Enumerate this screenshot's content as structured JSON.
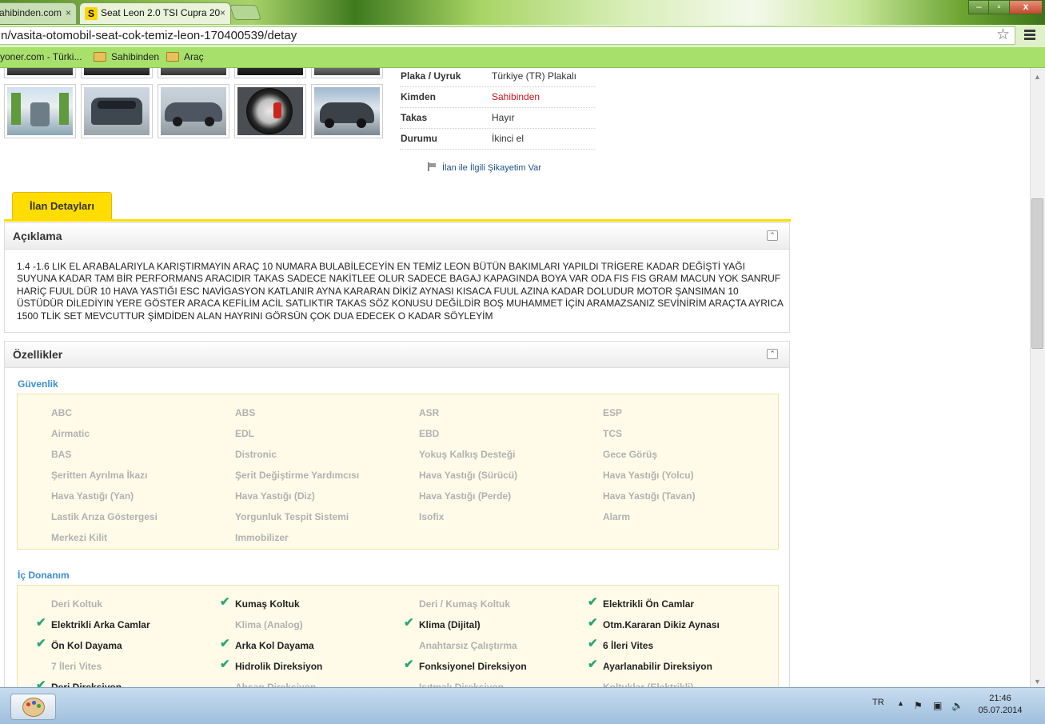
{
  "browser": {
    "tabs": [
      {
        "label": "ahibinden.com",
        "active": false
      },
      {
        "label": "Seat Leon 2.0 TSI Cupra 20",
        "active": true,
        "favicon_letter": "S"
      }
    ],
    "close_glyph": "×",
    "url": "n/vasita-otomobil-seat-cok-temiz-leon-170400539/detay",
    "bookmarks": [
      "yoner.com - Türki...",
      "Sahibinden",
      "Araç"
    ],
    "window_buttons": {
      "minimize": "–",
      "maximize": "▫",
      "close": "x"
    }
  },
  "listing_info": [
    {
      "label": "Plaka / Uyruk",
      "value": "Türkiye (TR) Plakalı",
      "highlight": false
    },
    {
      "label": "Kimden",
      "value": "Sahibinden",
      "highlight": true
    },
    {
      "label": "Takas",
      "value": "Hayır",
      "highlight": false
    },
    {
      "label": "Durumu",
      "value": "İkinci el",
      "highlight": false
    }
  ],
  "complaint_link": "İlan ile İlgili Şikayetim Var",
  "detail_tab": "İlan Detayları",
  "description": {
    "title": "Açıklama",
    "text": "1.4 -1.6 LIK EL ARABALARIYLA KARIŞTIRMAYIN ARAÇ 10 NUMARA BULABİLECEYİN EN TEMİZ LEON BÜTÜN BAKIMLARI YAPILDI TRİGERE KADAR DEĞİŞTİ YAĞI SUYUNA KADAR TAM BİR PERFORMANS ARACIDIR TAKAS SADECE NAKİTLEE OLUR SADECE BAGAJ KAPAGINDA BOYA VAR ODA FIS FIS GRAM MACUN YOK SANRUF HARİÇ FUUL DÜR 10 HAVA YASTIĞI ESC NAVİGASYON KATLANIR AYNA KARARAN DİKİZ AYNASI KISACA FUUL AZINA KADAR DOLUDUR MOTOR ŞANSIMAN 10 ÜSTÜDÜR DİLEDİYIN YERE GÖSTER ARACA KEFİLİM ACİL SATLIKTIR TAKAS SÖZ KONUSU DEĞİLDİR BOŞ MUHAMMET İÇİN ARAMAZSANIZ SEVİNİRİM ARAÇTA AYRICA 1500 TLİK SET MEVCUTTUR ŞİMDİDEN ALAN HAYRINI GÖRSÜN ÇOK DUA EDECEK O KADAR SÖYLEYİM"
  },
  "features": {
    "title": "Özellikler",
    "groups": [
      {
        "title": "Güvenlik",
        "items": [
          {
            "label": "ABC",
            "checked": false
          },
          {
            "label": "ABS",
            "checked": false
          },
          {
            "label": "ASR",
            "checked": false
          },
          {
            "label": "ESP",
            "checked": false
          },
          {
            "label": "Airmatic",
            "checked": false
          },
          {
            "label": "EDL",
            "checked": false
          },
          {
            "label": "EBD",
            "checked": false
          },
          {
            "label": "TCS",
            "checked": false
          },
          {
            "label": "BAS",
            "checked": false
          },
          {
            "label": "Distronic",
            "checked": false
          },
          {
            "label": "Yokuş Kalkış Desteği",
            "checked": false
          },
          {
            "label": "Gece Görüş",
            "checked": false
          },
          {
            "label": "Şeritten Ayrılma İkazı",
            "checked": false
          },
          {
            "label": "Şerit Değiştirme Yardımcısı",
            "checked": false
          },
          {
            "label": "Hava Yastığı (Sürücü)",
            "checked": false
          },
          {
            "label": "Hava Yastığı (Yolcu)",
            "checked": false
          },
          {
            "label": "Hava Yastığı (Yan)",
            "checked": false
          },
          {
            "label": "Hava Yastığı (Diz)",
            "checked": false
          },
          {
            "label": "Hava Yastığı (Perde)",
            "checked": false
          },
          {
            "label": "Hava Yastığı (Tavan)",
            "checked": false
          },
          {
            "label": "Lastik Arıza Göstergesi",
            "checked": false
          },
          {
            "label": "Yorgunluk Tespit Sistemi",
            "checked": false
          },
          {
            "label": "Isofix",
            "checked": false
          },
          {
            "label": "Alarm",
            "checked": false
          },
          {
            "label": "Merkezi Kilit",
            "checked": false
          },
          {
            "label": "Immobilizer",
            "checked": false
          }
        ]
      },
      {
        "title": "İç Donanım",
        "items": [
          {
            "label": "Deri Koltuk",
            "checked": false
          },
          {
            "label": "Kumaş Koltuk",
            "checked": true
          },
          {
            "label": "Deri / Kumaş Koltuk",
            "checked": false
          },
          {
            "label": "Elektrikli Ön Camlar",
            "checked": true
          },
          {
            "label": "Elektrikli Arka Camlar",
            "checked": true
          },
          {
            "label": "Klima (Analog)",
            "checked": false
          },
          {
            "label": "Klima (Dijital)",
            "checked": true
          },
          {
            "label": "Otm.Kararan Dikiz Aynası",
            "checked": true
          },
          {
            "label": "Ön Kol Dayama",
            "checked": true
          },
          {
            "label": "Arka Kol Dayama",
            "checked": true
          },
          {
            "label": "Anahtarsız Çalıştırma",
            "checked": false
          },
          {
            "label": "6 İleri Vites",
            "checked": true
          },
          {
            "label": "7 İleri Vites",
            "checked": false
          },
          {
            "label": "Hidrolik Direksiyon",
            "checked": true
          },
          {
            "label": "Fonksiyonel Direksiyon",
            "checked": true
          },
          {
            "label": "Ayarlanabilir Direksiyon",
            "checked": true
          },
          {
            "label": "Deri Direksiyon",
            "checked": true
          },
          {
            "label": "Ahşap Direksiyon",
            "checked": false
          },
          {
            "label": "Isıtmalı Direksiyon",
            "checked": false
          },
          {
            "label": "Koltuklar (Elektrikli)",
            "checked": false
          }
        ]
      }
    ]
  },
  "taskbar": {
    "language": "TR",
    "time": "21:46",
    "date": "05.07.2014"
  },
  "colors": {
    "accent_yellow": "#ffdd00",
    "link_blue": "#3a8fd6",
    "seller_red": "#c4161c",
    "check_green": "#2aa676"
  }
}
